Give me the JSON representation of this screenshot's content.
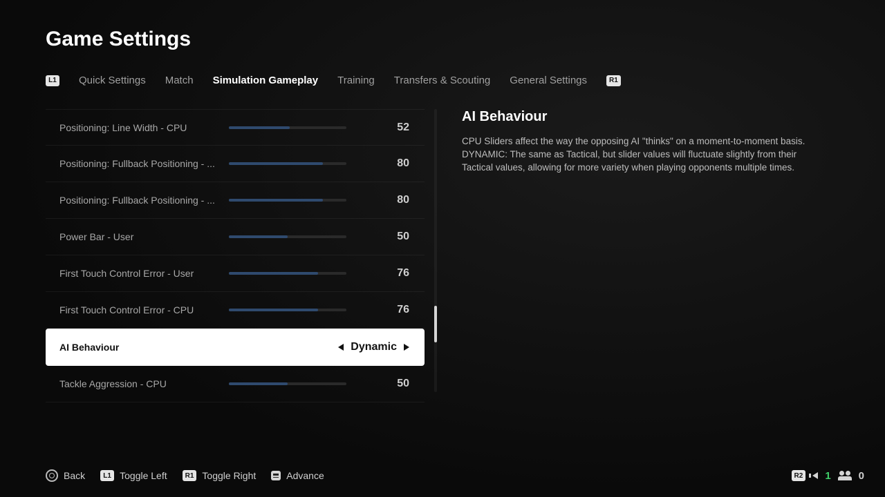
{
  "title": "Game Settings",
  "bumpers": {
    "left": "L1",
    "right": "R1",
    "r2": "R2"
  },
  "tabs": [
    {
      "label": "Quick Settings",
      "active": false
    },
    {
      "label": "Match",
      "active": false
    },
    {
      "label": "Simulation Gameplay",
      "active": true
    },
    {
      "label": "Training",
      "active": false
    },
    {
      "label": "Transfers & Scouting",
      "active": false
    },
    {
      "label": "General Settings",
      "active": false
    }
  ],
  "rows": [
    {
      "label": "Positioning: Line Width - CPU",
      "value": 52,
      "type": "slider"
    },
    {
      "label": "Positioning: Fullback Positioning - ...",
      "value": 80,
      "type": "slider"
    },
    {
      "label": "Positioning: Fullback Positioning - ...",
      "value": 80,
      "type": "slider"
    },
    {
      "label": "Power Bar - User",
      "value": 50,
      "type": "slider"
    },
    {
      "label": "First Touch Control Error - User",
      "value": 76,
      "type": "slider"
    },
    {
      "label": "First Touch Control Error - CPU",
      "value": 76,
      "type": "slider"
    },
    {
      "label": "AI Behaviour",
      "value": "Dynamic",
      "type": "select",
      "selected": true
    },
    {
      "label": "Tackle Aggression - CPU",
      "value": 50,
      "type": "slider"
    }
  ],
  "detail": {
    "title": "AI Behaviour",
    "description": "CPU Sliders affect the way the opposing AI \"thinks\" on a moment-to-moment basis. DYNAMIC: The same as Tactical, but slider values will fluctuate slightly from their Tactical values, allowing for more variety when playing opponents multiple times."
  },
  "footer": {
    "back": "Back",
    "toggle_left": "Toggle Left",
    "toggle_right": "Toggle Right",
    "advance": "Advance",
    "voice_count": "1",
    "party_count": "0"
  }
}
